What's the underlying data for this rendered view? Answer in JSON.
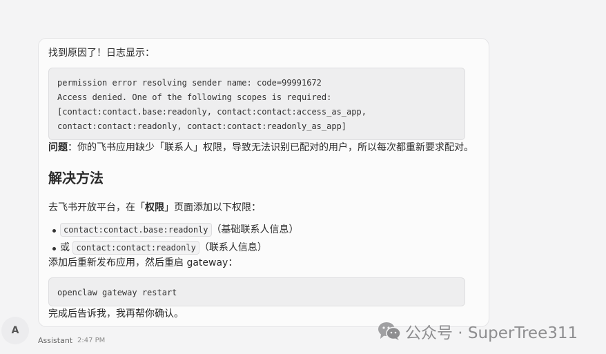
{
  "message": {
    "intro": "找到原因了！日志显示：",
    "log_lines": [
      "permission error resolving sender name: code=99991672",
      "Access denied. One of the following scopes is required:",
      "[contact:contact.base:readonly, contact:contact:access_as_app,",
      "contact:contact:readonly, contact:contact:readonly_as_app]"
    ],
    "problem_label": "问题",
    "problem_text": "：你的飞书应用缺少「联系人」权限，导致无法识别已配对的用户，所以每次都重新要求配对。",
    "solution_heading": "解决方法",
    "step_prefix": "去飞书开放平台，在「",
    "step_bold": "权限",
    "step_suffix": "」页面添加以下权限：",
    "bullets": [
      {
        "prefix": "",
        "code": "contact:contact.base:readonly",
        "note": "（基础联系人信息）"
      },
      {
        "prefix": "或",
        "code": "contact:contact:readonly",
        "note": "（联系人信息）"
      }
    ],
    "restart_text": "添加后重新发布应用，然后重启 gateway：",
    "restart_command": "openclaw gateway restart",
    "closing": "完成后告诉我，我再帮你确认。"
  },
  "sender": {
    "avatar_letter": "A",
    "name": "Assistant",
    "time": "2:47 PM"
  },
  "watermark": {
    "text": "公众号 · SuperTree311",
    "icon": "wechat-icon"
  }
}
